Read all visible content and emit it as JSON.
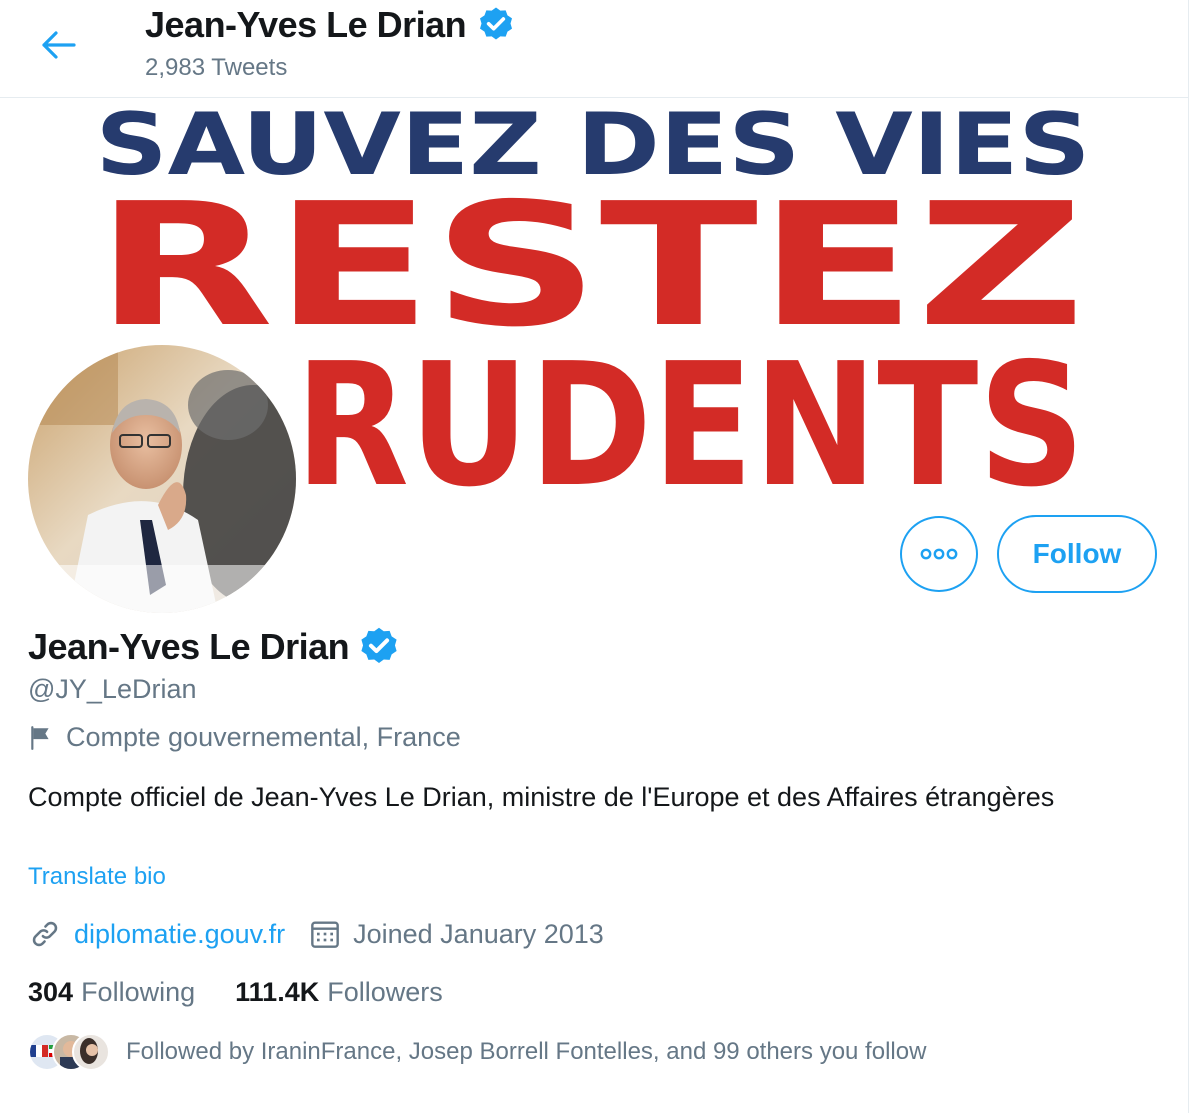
{
  "header": {
    "name": "Jean-Yves Le Drian",
    "tweet_count": "2,983 Tweets"
  },
  "banner": {
    "line1": "SAUVEZ DES VIES",
    "line2": "RESTEZ",
    "line3": "RUDENTS",
    "colors": {
      "navy": "#263b6e",
      "red": "#d32b26"
    }
  },
  "actions": {
    "more_icon": "more-horizontal-icon",
    "follow_label": "Follow"
  },
  "profile": {
    "name": "Jean-Yves Le Drian",
    "handle": "@JY_LeDrian",
    "label": "Compte gouvernemental, France",
    "bio": "Compte officiel de Jean-Yves Le Drian, ministre de l'Europe et des Affaires étrangères",
    "translate_label": "Translate bio",
    "website": "diplomatie.gouv.fr",
    "joined": "Joined January 2013"
  },
  "stats": {
    "following_count": "304",
    "following_label": "Following",
    "followers_count": "111.4K",
    "followers_label": "Followers"
  },
  "followed_by": "Followed by IraninFrance, Josep Borrell Fontelles, and 99 others you follow",
  "colors": {
    "accent": "#1da1f2",
    "verified": "#1da1f2",
    "muted_text": "#657786",
    "primary_text": "#14171a"
  }
}
